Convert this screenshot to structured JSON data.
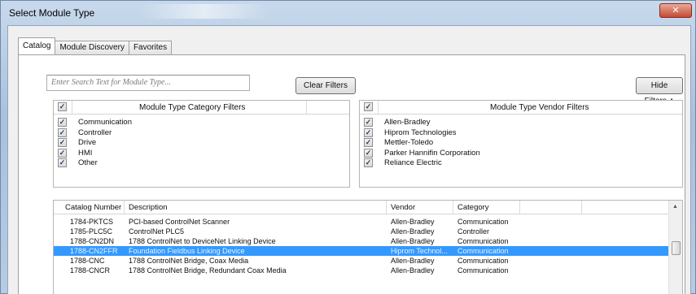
{
  "window": {
    "title": "Select Module Type",
    "close_glyph": "✕"
  },
  "tabs": [
    {
      "label": "Catalog",
      "active": true
    },
    {
      "label": "Module Discovery",
      "active": false
    },
    {
      "label": "Favorites",
      "active": false
    }
  ],
  "search": {
    "placeholder": "Enter Search Text for Module Type..."
  },
  "buttons": {
    "clear_filters": "Clear Filters",
    "hide_filters": "Hide Filters",
    "hide_filters_icon": "chevron-up-double"
  },
  "category_filters": {
    "header": "Module Type Category Filters",
    "items": [
      "Communication",
      "Controller",
      "Drive",
      "HMI",
      "Other"
    ]
  },
  "vendor_filters": {
    "header": "Module Type Vendor Filters",
    "items": [
      "Allen-Bradley",
      "Hiprom Technologies",
      "Mettler-Toledo",
      "Parker Hannifin Corporation",
      "Reliance Electric"
    ]
  },
  "check_glyph": "✓",
  "grid": {
    "columns": [
      "Catalog Number",
      "Description",
      "Vendor",
      "Category"
    ],
    "rows": [
      {
        "catalog": "1784-PKTCS",
        "description": "PCI-based ControlNet Scanner",
        "vendor": "Allen-Bradley",
        "category": "Communication"
      },
      {
        "catalog": "1785-PLC5C",
        "description": "ControlNet PLC5",
        "vendor": "Allen-Bradley",
        "category": "Controller"
      },
      {
        "catalog": "1788-CN2DN",
        "description": "1788 ControlNet to DeviceNet Linking Device",
        "vendor": "Allen-Bradley",
        "category": "Communication"
      },
      {
        "catalog": "1788-CN2FFR",
        "description": "Foundation Fieldbus Linking Device",
        "vendor": "Hiprom Technol...",
        "category": "Communication",
        "selected": true
      },
      {
        "catalog": "1788-CNC",
        "description": "1788 ControlNet Bridge, Coax Media",
        "vendor": "Allen-Bradley",
        "category": "Communication"
      },
      {
        "catalog": "1788-CNCR",
        "description": "1788 ControlNet Bridge, Redundant Coax Media",
        "vendor": "Allen-Bradley",
        "category": "Communication"
      }
    ]
  },
  "colors": {
    "selection": "#3399ff",
    "title_bar": "#b9cde3"
  }
}
